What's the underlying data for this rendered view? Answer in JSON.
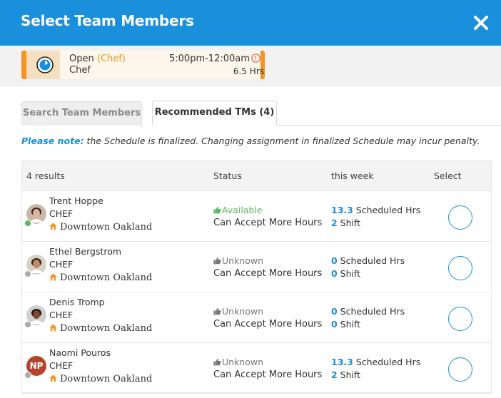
{
  "header": {
    "title": "Select Team Members",
    "close_icon": "close-x-icon"
  },
  "shift": {
    "status": "Open",
    "role_paren": "(Chef)",
    "role": "Chef",
    "time": "5:00pm-12:00am",
    "hours": "6.5 Hrs",
    "accent_color": "#f7941d"
  },
  "tabs": [
    {
      "label": "Search Team Members",
      "active": false
    },
    {
      "label": "Recommended TMs (4)",
      "active": true
    }
  ],
  "note": {
    "lead": "Please note:",
    "text": " the Schedule is finalized. Changing assignment in finalized Schedule may incur penalty."
  },
  "table": {
    "headers": {
      "results": "4 results",
      "status": "Status",
      "week": "this week",
      "select": "Select"
    },
    "rows": [
      {
        "name": "Trent Hoppe",
        "role": "CHEF",
        "location": "Downtown Oakland",
        "availability": "Available",
        "availability_color": "#5cb85c",
        "accept": "Can Accept More Hours",
        "hours": "13.3",
        "hours_label": " Scheduled Hrs",
        "shifts": "2",
        "shifts_label": " Shift",
        "presence": "online",
        "avatar": "photo"
      },
      {
        "name": "Ethel Bergstrom",
        "role": "CHEF",
        "location": "Downtown Oakland",
        "availability": "Unknown",
        "availability_color": "#777777",
        "accept": "Can Accept More Hours",
        "hours": "0",
        "hours_label": " Scheduled Hrs",
        "shifts": "0",
        "shifts_label": " Shift",
        "presence": "offline",
        "avatar": "photo"
      },
      {
        "name": "Denis Tromp",
        "role": "CHEF",
        "location": "Downtown Oakland",
        "availability": "Unknown",
        "availability_color": "#777777",
        "accept": "Can Accept More Hours",
        "hours": "0",
        "hours_label": " Scheduled Hrs",
        "shifts": "0",
        "shifts_label": " Shift",
        "presence": "offline",
        "avatar": "photo"
      },
      {
        "name": "Naomi Pouros",
        "role": "CHEF",
        "location": "Downtown Oakland",
        "availability": "Unknown",
        "availability_color": "#777777",
        "accept": "Can Accept More Hours",
        "hours": "13.3",
        "hours_label": " Scheduled Hrs",
        "shifts": "2",
        "shifts_label": " Shift",
        "presence": "offline",
        "avatar": "initials",
        "initials": "NP"
      }
    ]
  }
}
